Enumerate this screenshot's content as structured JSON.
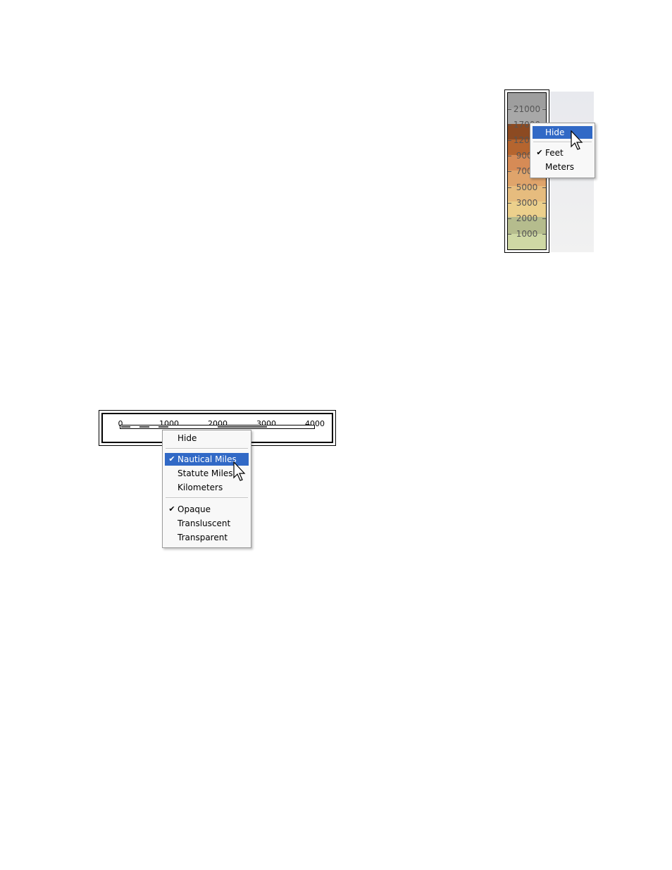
{
  "elevation_legend": {
    "labels": [
      "21000",
      "17000",
      "12000",
      "9000",
      "7000",
      "5000",
      "3000",
      "2000",
      "1000"
    ],
    "band_colors": [
      "#9e9e9e",
      "#a8a8a8",
      "#8c4a22",
      "#b5652f",
      "#d68b56",
      "#dfa46b",
      "#e6bc7e",
      "#ecd08c",
      "#b5bc8d",
      "#cfd8a4"
    ]
  },
  "elevation_menu": {
    "items": [
      {
        "label": "Hide",
        "checked": false,
        "selected": true
      },
      {
        "label": "Feet",
        "checked": true,
        "selected": false
      },
      {
        "label": "Meters",
        "checked": false,
        "selected": false
      }
    ]
  },
  "scale_bar": {
    "ticks": [
      "0",
      "1000",
      "2000",
      "3000",
      "4000"
    ]
  },
  "scale_menu": {
    "items": [
      {
        "label": "Hide",
        "checked": false,
        "selected": false
      },
      {
        "label": "Nautical Miles",
        "checked": true,
        "selected": true
      },
      {
        "label": "Statute Miles",
        "checked": false,
        "selected": false
      },
      {
        "label": "Kilometers",
        "checked": false,
        "selected": false
      },
      {
        "label": "Opaque",
        "checked": true,
        "selected": false
      },
      {
        "label": "Transluscent",
        "checked": false,
        "selected": false
      },
      {
        "label": "Transparent",
        "checked": false,
        "selected": false
      }
    ]
  },
  "colors": {
    "menu_highlight": "#3169c6",
    "check_mark": "✔"
  }
}
